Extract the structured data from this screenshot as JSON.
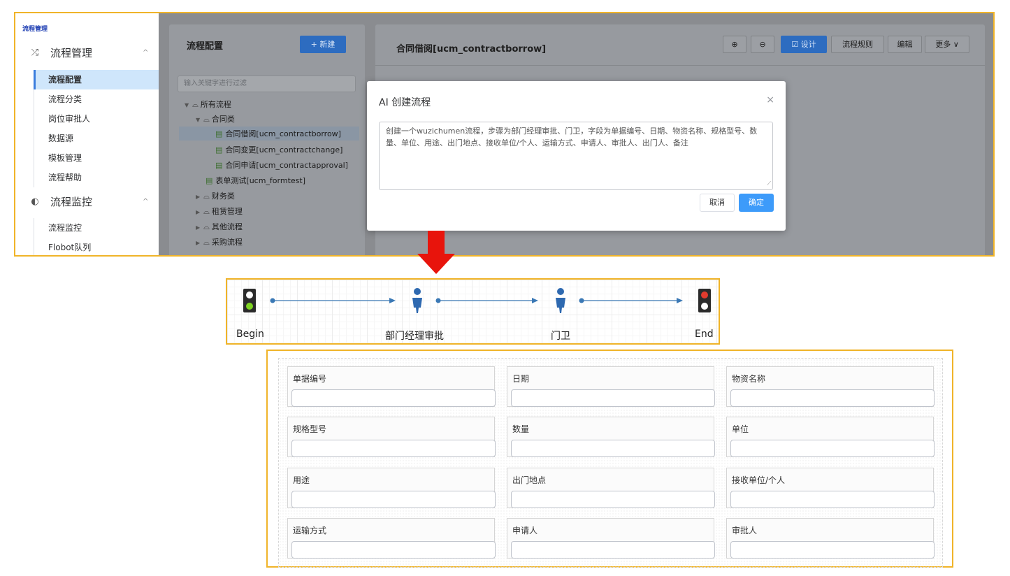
{
  "sidebar": {
    "header": "流程管理",
    "groups": [
      {
        "label": "流程管理",
        "icon": "shuffle-icon"
      },
      {
        "label": "流程监控",
        "icon": "shield-icon"
      }
    ],
    "items": [
      "流程配置",
      "流程分类",
      "岗位审批人",
      "数据源",
      "模板管理",
      "流程帮助",
      "流程监控",
      "Flobot队列"
    ]
  },
  "left_panel": {
    "title": "流程配置",
    "new_button": "+ 新建",
    "filter_placeholder": "输入关键字进行过滤",
    "tree": {
      "root": "所有流程",
      "group1": "合同类",
      "docs": [
        "合同借阅[ucm_contractborrow]",
        "合同变更[ucm_contractchange]",
        "合同申请[ucm_contractapproval]",
        "表单测试[ucm_formtest]"
      ],
      "folders": [
        "财务类",
        "租赁管理",
        "其他流程",
        "采购流程"
      ]
    }
  },
  "right_panel": {
    "title": "合同借阅[ucm_contractborrow]",
    "toolbar": {
      "zoom_in": "⊕",
      "zoom_out": "⊖",
      "design": "☑ 设计",
      "rules": "流程规则",
      "edit": "编辑",
      "more": "更多 ∨"
    }
  },
  "modal": {
    "title": "AI 创建流程",
    "close": "×",
    "prompt": "创建一个wuzichumen流程，步骤为部门经理审批、门卫，字段为单据编号、日期、物资名称、规格型号、数量、单位、用途、出门地点、接收单位/个人、运输方式、申请人、审批人、出门人、备注",
    "cancel": "取消",
    "confirm": "确定"
  },
  "flow": {
    "nodes": [
      "Begin",
      "部门经理审批",
      "门卫",
      "End"
    ]
  },
  "form": {
    "fields": [
      "单据编号",
      "日期",
      "物资名称",
      "规格型号",
      "数量",
      "单位",
      "用途",
      "出门地点",
      "接收单位/个人",
      "运输方式",
      "申请人",
      "审批人"
    ]
  },
  "colors": {
    "highlight_border": "#f0b429",
    "primary": "#3d9bfa",
    "arrow": "#e8140c",
    "flow_line": "#3a78b5"
  }
}
